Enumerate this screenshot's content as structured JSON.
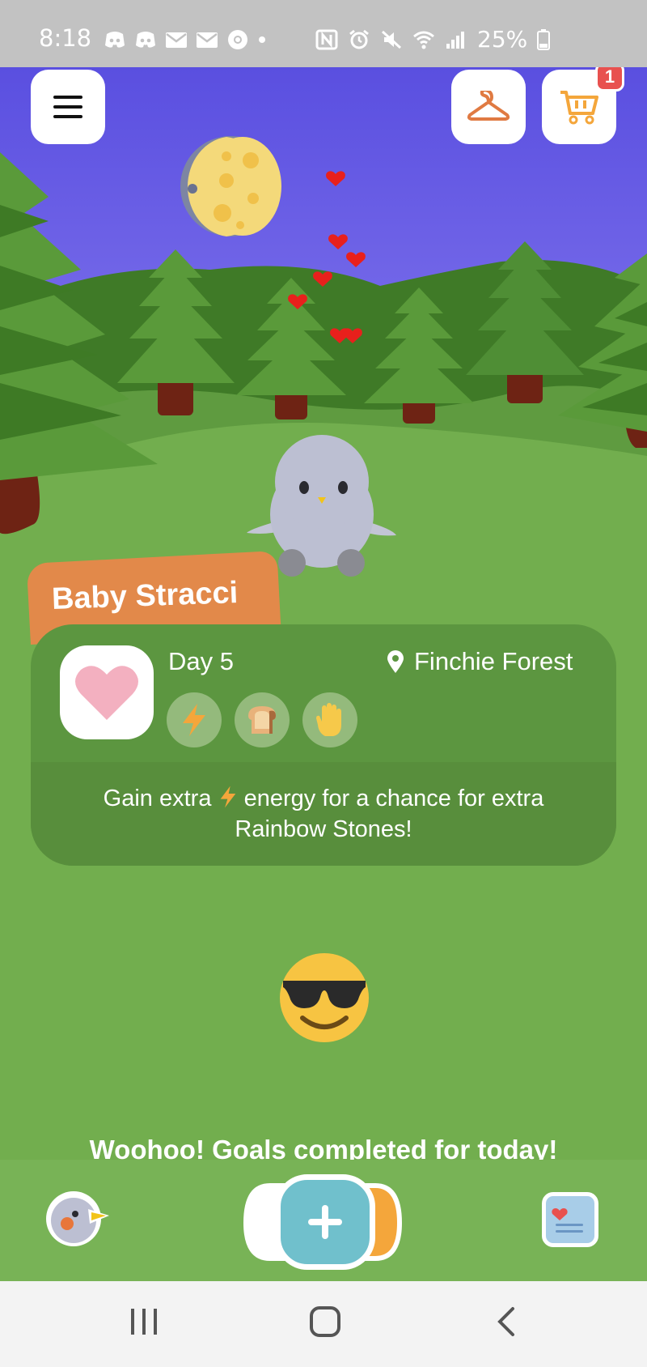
{
  "status_bar": {
    "time": "8:18",
    "battery": "25%"
  },
  "header": {
    "cart_badge": "1"
  },
  "pet": {
    "name": "Baby Stracci",
    "day": "Day 5",
    "location": "Finchie Forest",
    "tip_before": "Gain extra",
    "tip_after": "energy for a chance for extra Rainbow Stones!",
    "stats": [
      "energy-icon",
      "bread-icon",
      "hand-icon"
    ]
  },
  "goals": {
    "message": "Woohoo! Goals completed for today!"
  },
  "colors": {
    "sky": "#5a55dd",
    "grass": "#72ae4e",
    "card": "#5c9640",
    "name_tab": "#e2894a",
    "add_button": "#70c0cc",
    "badge": "#e8514f"
  }
}
